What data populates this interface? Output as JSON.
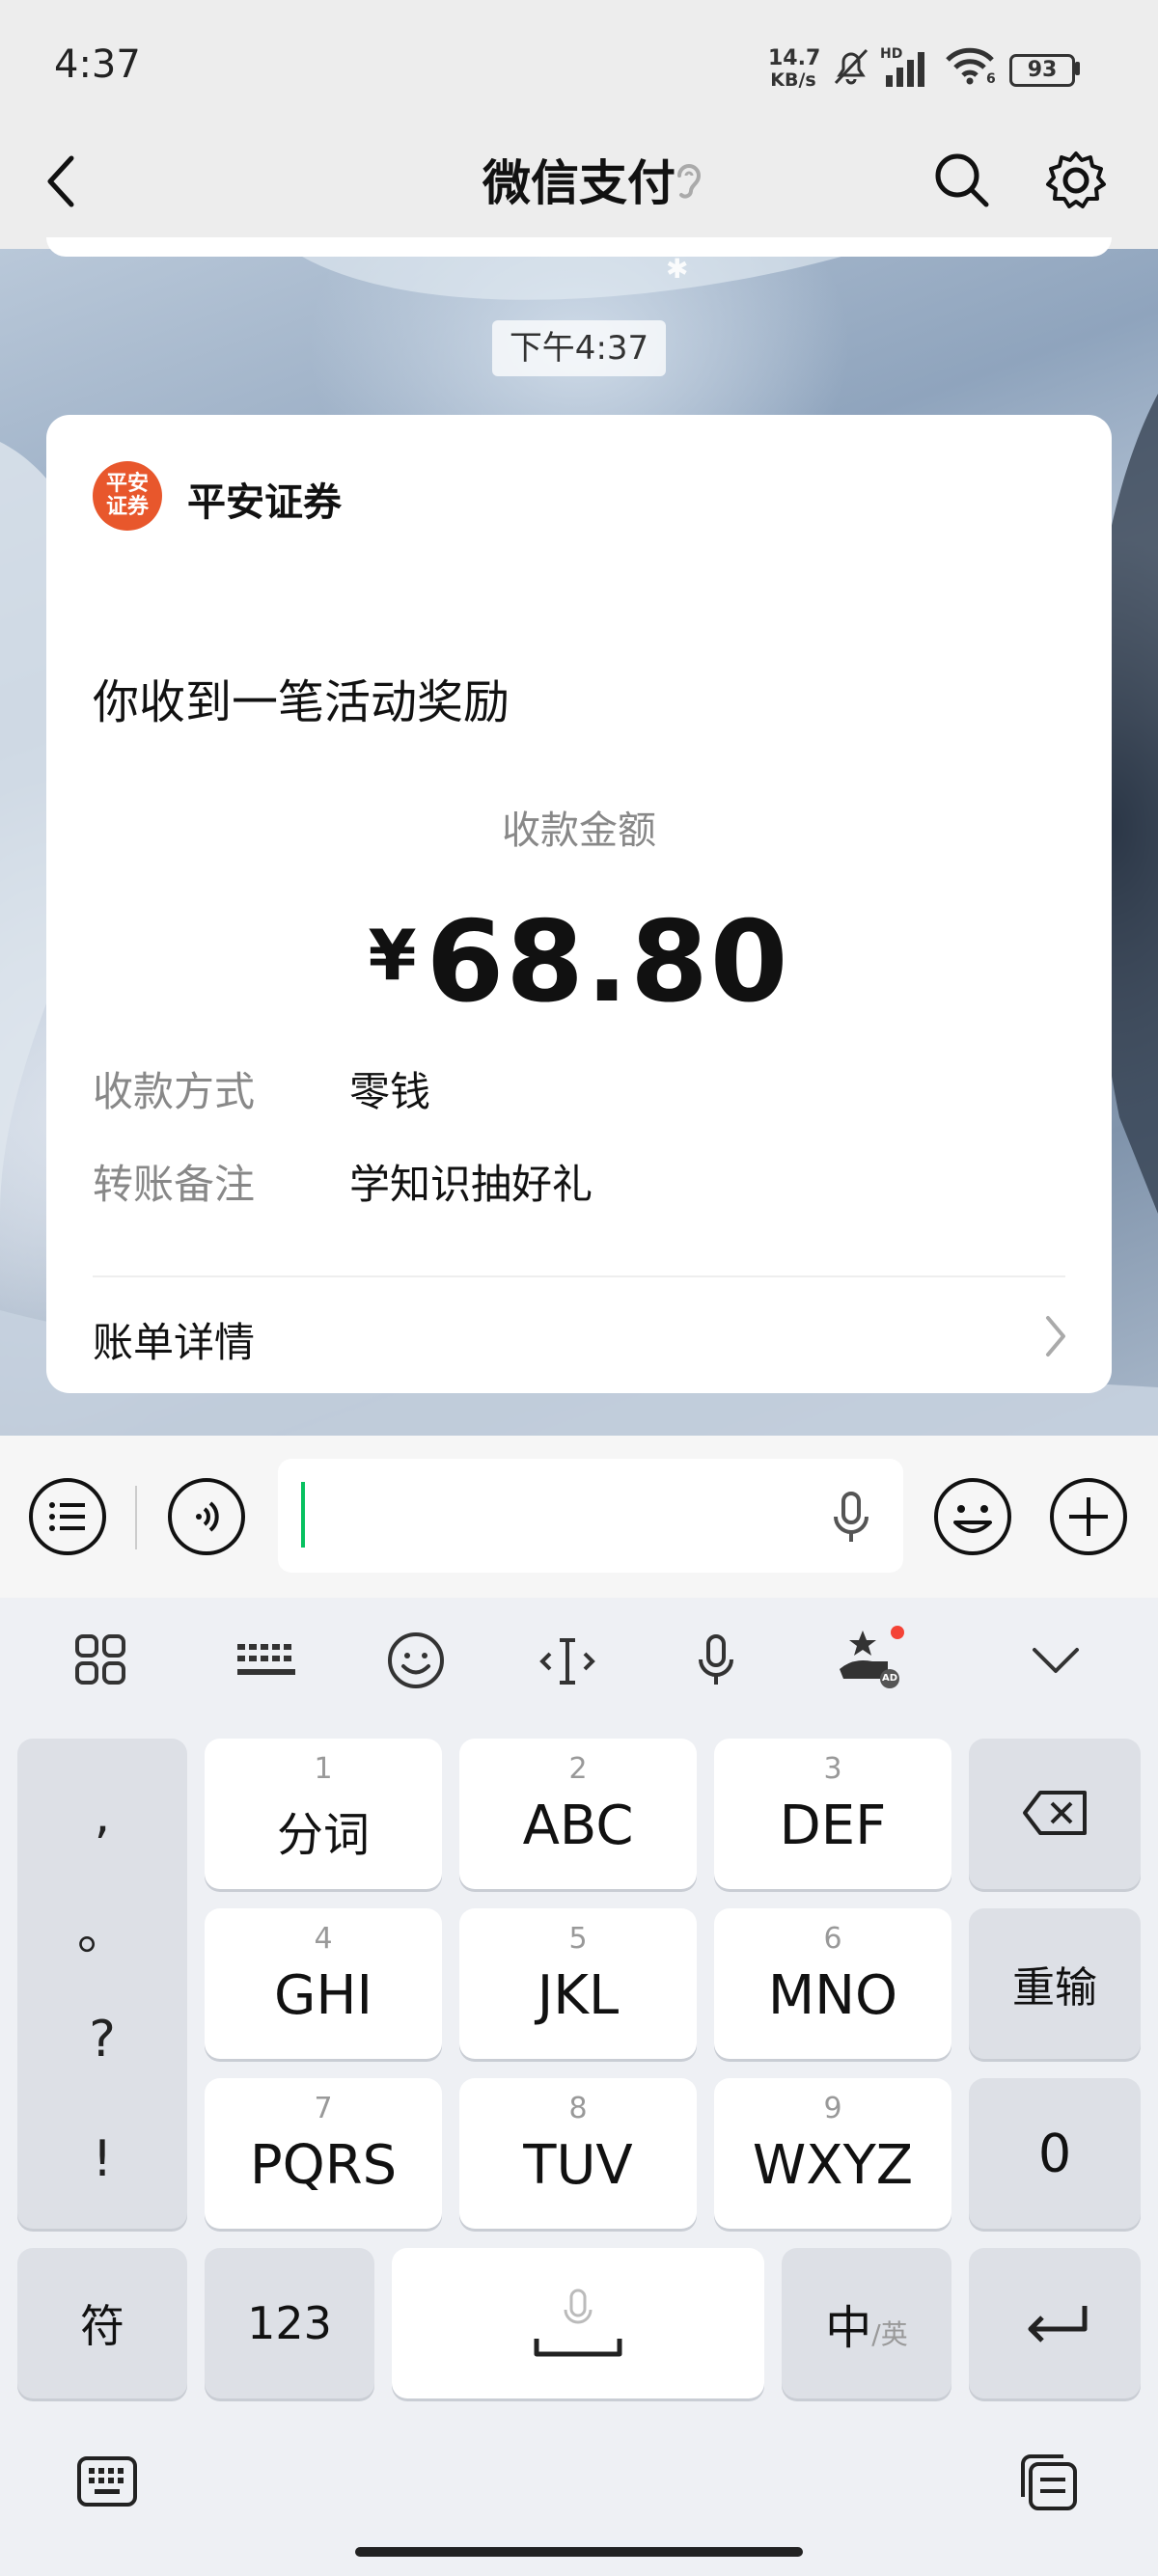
{
  "status_bar": {
    "time": "4:37",
    "net_speed_value": "14.7",
    "net_speed_unit": "KB/s",
    "hd_label": "HD",
    "wifi_label": "6",
    "battery": "93"
  },
  "nav": {
    "title": "微信支付"
  },
  "chat": {
    "timestamp": "下午4:37"
  },
  "card": {
    "logo_text": "平安证券",
    "sender": "平安证券",
    "headline": "你收到一笔活动奖励",
    "amount_label": "收款金额",
    "currency": "¥",
    "amount": "68.80",
    "details": [
      {
        "label": "收款方式",
        "value": "零钱"
      },
      {
        "label": "转账备注",
        "value": "学知识抽好礼"
      }
    ],
    "bill_detail": "账单详情"
  },
  "keyboard": {
    "punct": [
      ",",
      "。",
      "?",
      "!"
    ],
    "keys": [
      {
        "num": "1",
        "label": "分词"
      },
      {
        "num": "2",
        "label": "ABC"
      },
      {
        "num": "3",
        "label": "DEF"
      },
      {
        "num": "4",
        "label": "GHI"
      },
      {
        "num": "5",
        "label": "JKL"
      },
      {
        "num": "6",
        "label": "MNO"
      },
      {
        "num": "7",
        "label": "PQRS"
      },
      {
        "num": "8",
        "label": "TUV"
      },
      {
        "num": "9",
        "label": "WXYZ"
      }
    ],
    "reinput": "重输",
    "zero": "0",
    "symbol": "符",
    "num_mode": "123",
    "lang_main": "中",
    "lang_alt": "/英",
    "toolbar_badge": "AD"
  }
}
